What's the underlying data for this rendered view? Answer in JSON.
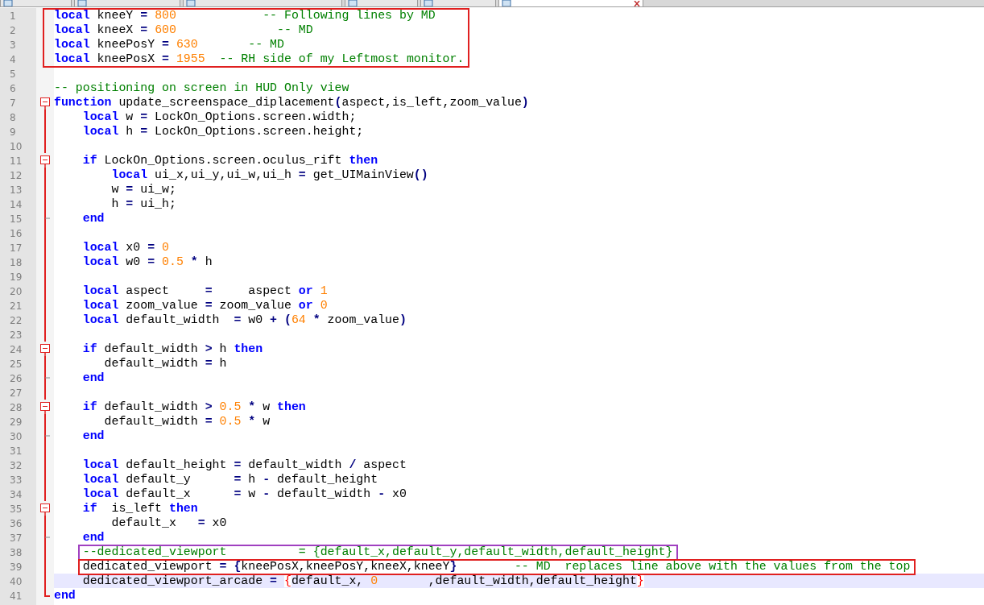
{
  "tabs": [
    {
      "selected": false
    },
    {
      "selected": false
    },
    {
      "selected": false
    },
    {
      "selected": false
    },
    {
      "selected": false
    },
    {
      "selected": true
    }
  ],
  "lines": [
    {
      "number": "1",
      "kind": "plain",
      "color": "#e02020",
      "current": false,
      "segments": [
        {
          "kind": "keyword",
          "text": "local"
        },
        {
          "kind": "text",
          "text": " kneeY "
        },
        {
          "kind": "operator",
          "text": "= "
        },
        {
          "kind": "number",
          "text": "800            "
        },
        {
          "kind": "comment",
          "text": "-- Following lines by MD"
        }
      ]
    },
    {
      "number": "2",
      "kind": "plain",
      "color": "#e02020",
      "current": false,
      "segments": [
        {
          "kind": "keyword",
          "text": "local"
        },
        {
          "kind": "text",
          "text": " kneeX "
        },
        {
          "kind": "operator",
          "text": "= "
        },
        {
          "kind": "number",
          "text": "600              "
        },
        {
          "kind": "comment",
          "text": "-- MD"
        }
      ]
    },
    {
      "number": "3",
      "kind": "plain",
      "color": "#e02020",
      "current": false,
      "segments": [
        {
          "kind": "keyword",
          "text": "local"
        },
        {
          "kind": "text",
          "text": " kneePosY "
        },
        {
          "kind": "operator",
          "text": "= "
        },
        {
          "kind": "number",
          "text": "630       "
        },
        {
          "kind": "comment",
          "text": "-- MD"
        }
      ]
    },
    {
      "number": "4",
      "kind": "plain",
      "color": "#e02020",
      "current": false,
      "segments": [
        {
          "kind": "keyword",
          "text": "local"
        },
        {
          "kind": "text",
          "text": " kneePosX "
        },
        {
          "kind": "operator",
          "text": "= "
        },
        {
          "kind": "number",
          "text": "1955  "
        },
        {
          "kind": "comment",
          "text": "-- RH side of my Leftmost monitor."
        }
      ]
    },
    {
      "number": "5",
      "kind": "plain",
      "current": false
    },
    {
      "number": "6",
      "kind": "plain",
      "current": false,
      "segments": [
        {
          "kind": "comment",
          "text": "-- positioning on screen in HUD Only view"
        }
      ]
    },
    {
      "number": "7",
      "kind": "fold-start",
      "current": false,
      "segments": [
        {
          "kind": "keyword",
          "text": "function"
        },
        {
          "kind": "text",
          "text": " update_screenspace_diplacement"
        },
        {
          "kind": "operator",
          "text": "("
        },
        {
          "kind": "text",
          "text": "aspect,is_left,zoom_value"
        },
        {
          "kind": "operator",
          "text": ")"
        }
      ]
    },
    {
      "number": "8",
      "kind": "folded",
      "current": false,
      "segments": [
        {
          "kind": "keyword",
          "text": "    local"
        },
        {
          "kind": "text",
          "text": " w "
        },
        {
          "kind": "operator",
          "text": "="
        },
        {
          "kind": "text",
          "text": " LockOn_Options.screen.width;"
        }
      ]
    },
    {
      "number": "9",
      "kind": "folded",
      "current": false,
      "segments": [
        {
          "kind": "keyword",
          "text": "    local"
        },
        {
          "kind": "text",
          "text": " h "
        },
        {
          "kind": "operator",
          "text": "="
        },
        {
          "kind": "text",
          "text": " LockOn_Options.screen.height;"
        }
      ]
    },
    {
      "number": "10",
      "kind": "folded",
      "current": false
    },
    {
      "number": "11",
      "kind": "fold-start",
      "current": false,
      "segments": [
        {
          "kind": "keyword",
          "text": "    if"
        },
        {
          "kind": "text",
          "text": " LockOn_Options.screen.oculus_rift "
        },
        {
          "kind": "keyword",
          "text": "then"
        }
      ]
    },
    {
      "number": "12",
      "kind": "folded",
      "current": false,
      "segments": [
        {
          "kind": "keyword",
          "text": "        local"
        },
        {
          "kind": "text",
          "text": " ui_x,ui_y,ui_w,ui_h "
        },
        {
          "kind": "operator",
          "text": "="
        },
        {
          "kind": "text",
          "text": " get_UIMainView"
        },
        {
          "kind": "operator",
          "text": "()"
        }
      ]
    },
    {
      "number": "13",
      "kind": "folded",
      "current": false,
      "segments": [
        {
          "kind": "text",
          "text": "        w "
        },
        {
          "kind": "operator",
          "text": "="
        },
        {
          "kind": "text",
          "text": " ui_w;"
        }
      ]
    },
    {
      "number": "14",
      "kind": "folded",
      "current": false,
      "segments": [
        {
          "kind": "text",
          "text": "        h "
        },
        {
          "kind": "operator",
          "text": "="
        },
        {
          "kind": "text",
          "text": " ui_h;"
        }
      ]
    },
    {
      "number": "15",
      "kind": "fold-end",
      "current": false,
      "segments": [
        {
          "kind": "keyword",
          "text": "    end"
        }
      ]
    },
    {
      "number": "16",
      "kind": "folded",
      "current": false
    },
    {
      "number": "17",
      "kind": "folded",
      "current": false,
      "segments": [
        {
          "kind": "keyword",
          "text": "    local"
        },
        {
          "kind": "text",
          "text": " x0 "
        },
        {
          "kind": "operator",
          "text": "= "
        },
        {
          "kind": "number",
          "text": "0"
        }
      ]
    },
    {
      "number": "18",
      "kind": "folded",
      "current": false,
      "segments": [
        {
          "kind": "keyword",
          "text": "    local"
        },
        {
          "kind": "text",
          "text": " w0 "
        },
        {
          "kind": "operator",
          "text": "= "
        },
        {
          "kind": "number",
          "text": "0.5 "
        },
        {
          "kind": "operator",
          "text": "*"
        },
        {
          "kind": "text",
          "text": " h"
        }
      ]
    },
    {
      "number": "19",
      "kind": "folded",
      "current": false
    },
    {
      "number": "20",
      "kind": "folded",
      "current": false,
      "segments": [
        {
          "kind": "keyword",
          "text": "    local"
        },
        {
          "kind": "text",
          "text": " aspect     "
        },
        {
          "kind": "operator",
          "text": "="
        },
        {
          "kind": "text",
          "text": "     aspect "
        },
        {
          "kind": "keyword",
          "text": "or "
        },
        {
          "kind": "number",
          "text": "1"
        }
      ]
    },
    {
      "number": "21",
      "kind": "folded",
      "current": false,
      "segments": [
        {
          "kind": "keyword",
          "text": "    local"
        },
        {
          "kind": "text",
          "text": " zoom_value "
        },
        {
          "kind": "operator",
          "text": "="
        },
        {
          "kind": "text",
          "text": " zoom_value "
        },
        {
          "kind": "keyword",
          "text": "or "
        },
        {
          "kind": "number",
          "text": "0"
        }
      ]
    },
    {
      "number": "22",
      "kind": "folded",
      "current": false,
      "segments": [
        {
          "kind": "keyword",
          "text": "    local"
        },
        {
          "kind": "text",
          "text": " default_width  "
        },
        {
          "kind": "operator",
          "text": "="
        },
        {
          "kind": "text",
          "text": " w0 "
        },
        {
          "kind": "operator",
          "text": "+ ("
        },
        {
          "kind": "number",
          "text": "64 "
        },
        {
          "kind": "operator",
          "text": "*"
        },
        {
          "kind": "text",
          "text": " zoom_value"
        },
        {
          "kind": "operator",
          "text": ")"
        }
      ]
    },
    {
      "number": "23",
      "kind": "folded",
      "current": false
    },
    {
      "number": "24",
      "kind": "fold-start",
      "current": false,
      "segments": [
        {
          "kind": "keyword",
          "text": "    if"
        },
        {
          "kind": "text",
          "text": " default_width "
        },
        {
          "kind": "operator",
          "text": ">"
        },
        {
          "kind": "text",
          "text": " h "
        },
        {
          "kind": "keyword",
          "text": "then"
        }
      ]
    },
    {
      "number": "25",
      "kind": "folded",
      "current": false,
      "segments": [
        {
          "kind": "text",
          "text": "       default_width "
        },
        {
          "kind": "operator",
          "text": "="
        },
        {
          "kind": "text",
          "text": " h"
        }
      ]
    },
    {
      "number": "26",
      "kind": "fold-end",
      "current": false,
      "segments": [
        {
          "kind": "keyword",
          "text": "    end"
        }
      ]
    },
    {
      "number": "27",
      "kind": "folded",
      "current": false
    },
    {
      "number": "28",
      "kind": "fold-start",
      "current": false,
      "segments": [
        {
          "kind": "keyword",
          "text": "    if"
        },
        {
          "kind": "text",
          "text": " default_width "
        },
        {
          "kind": "operator",
          "text": "> "
        },
        {
          "kind": "number",
          "text": "0.5 "
        },
        {
          "kind": "operator",
          "text": "*"
        },
        {
          "kind": "text",
          "text": " w "
        },
        {
          "kind": "keyword",
          "text": "then"
        }
      ]
    },
    {
      "number": "29",
      "kind": "folded",
      "current": false,
      "segments": [
        {
          "kind": "text",
          "text": "       default_width "
        },
        {
          "kind": "operator",
          "text": "= "
        },
        {
          "kind": "number",
          "text": "0.5 "
        },
        {
          "kind": "operator",
          "text": "*"
        },
        {
          "kind": "text",
          "text": " w"
        }
      ]
    },
    {
      "number": "30",
      "kind": "fold-end",
      "current": false,
      "segments": [
        {
          "kind": "keyword",
          "text": "    end"
        }
      ]
    },
    {
      "number": "31",
      "kind": "folded",
      "current": false
    },
    {
      "number": "32",
      "kind": "folded",
      "current": false,
      "segments": [
        {
          "kind": "keyword",
          "text": "    local"
        },
        {
          "kind": "text",
          "text": " default_height "
        },
        {
          "kind": "operator",
          "text": "="
        },
        {
          "kind": "text",
          "text": " default_width "
        },
        {
          "kind": "operator",
          "text": "/"
        },
        {
          "kind": "text",
          "text": " aspect"
        }
      ]
    },
    {
      "number": "33",
      "kind": "folded",
      "current": false,
      "segments": [
        {
          "kind": "keyword",
          "text": "    local"
        },
        {
          "kind": "text",
          "text": " default_y      "
        },
        {
          "kind": "operator",
          "text": "="
        },
        {
          "kind": "text",
          "text": " h "
        },
        {
          "kind": "operator",
          "text": "-"
        },
        {
          "kind": "text",
          "text": " default_height"
        }
      ]
    },
    {
      "number": "34",
      "kind": "folded",
      "current": false,
      "segments": [
        {
          "kind": "keyword",
          "text": "    local"
        },
        {
          "kind": "text",
          "text": " default_x      "
        },
        {
          "kind": "operator",
          "text": "="
        },
        {
          "kind": "text",
          "text": " w "
        },
        {
          "kind": "operator",
          "text": "-"
        },
        {
          "kind": "text",
          "text": " default_width "
        },
        {
          "kind": "operator",
          "text": "-"
        },
        {
          "kind": "text",
          "text": " x0"
        }
      ]
    },
    {
      "number": "35",
      "kind": "fold-start",
      "current": false,
      "segments": [
        {
          "kind": "keyword",
          "text": "    if"
        },
        {
          "kind": "text",
          "text": "  is_left "
        },
        {
          "kind": "keyword",
          "text": "then"
        }
      ]
    },
    {
      "number": "36",
      "kind": "folded",
      "current": false,
      "segments": [
        {
          "kind": "text",
          "text": "        default_x   "
        },
        {
          "kind": "operator",
          "text": "="
        },
        {
          "kind": "text",
          "text": " x0"
        }
      ]
    },
    {
      "number": "37",
      "kind": "fold-end",
      "current": false,
      "segments": [
        {
          "kind": "keyword",
          "text": "    end"
        }
      ]
    },
    {
      "number": "38",
      "kind": "folded",
      "color": "#a040c0",
      "current": false,
      "segments": [
        {
          "kind": "comment",
          "text": "    --dedicated_viewport          = {default_x,default_y,default_width,default_height}"
        }
      ]
    },
    {
      "number": "39",
      "kind": "folded",
      "color": "#e02020",
      "current": false,
      "segments": [
        {
          "kind": "text",
          "text": "    dedicated_viewport "
        },
        {
          "kind": "operator",
          "text": "= {"
        },
        {
          "kind": "text",
          "text": "kneePosX,kneePosY,kneeX,kneeY"
        },
        {
          "kind": "operator",
          "text": "}        "
        },
        {
          "kind": "comment",
          "text": "-- MD  replaces line above with the values from the top"
        }
      ]
    },
    {
      "number": "40",
      "kind": "folded",
      "current": true,
      "segments": [
        {
          "kind": "text",
          "text": "    dedicated_viewport_arcade "
        },
        {
          "kind": "operator",
          "text": "= "
        },
        {
          "kind": "brace-match",
          "text": "{"
        },
        {
          "kind": "text",
          "text": "default_x, "
        },
        {
          "kind": "number",
          "text": "0"
        },
        {
          "kind": "text",
          "text": "       ,default_width,default_height"
        },
        {
          "kind": "brace-match",
          "text": "}"
        }
      ]
    },
    {
      "number": "41",
      "kind": "fold-last",
      "current": false,
      "segments": [
        {
          "kind": "keyword",
          "text": "end"
        }
      ]
    }
  ]
}
